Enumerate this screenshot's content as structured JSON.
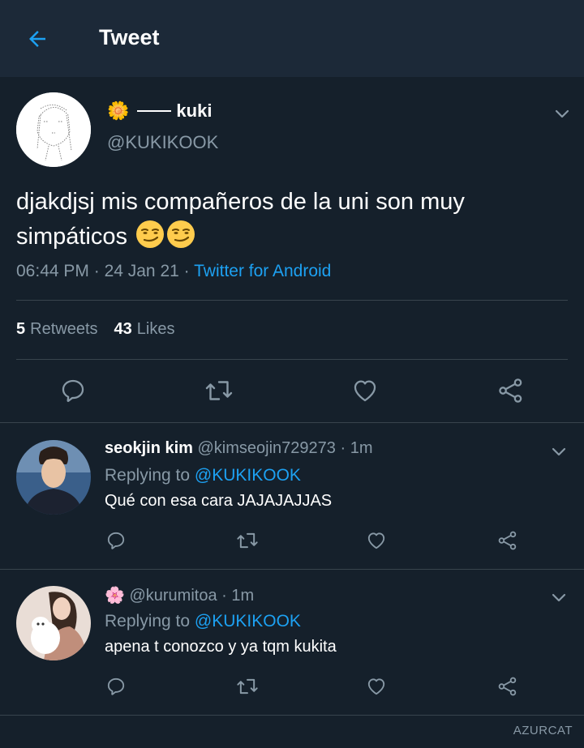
{
  "header": {
    "title": "Tweet"
  },
  "tweet": {
    "display_name": "kuki",
    "name_emoji": "🌼",
    "handle": "@KUKIKOOK",
    "text": "djakdjsj mis compañeros de la uni son muy simpáticos",
    "time": "06:44 PM",
    "date": "24 Jan 21",
    "client": "Twitter for Android",
    "retweets_count": "5",
    "retweets_label": "Retweets",
    "likes_count": "43",
    "likes_label": "Likes"
  },
  "replies": [
    {
      "name": "seokjin kim",
      "handle": "@kimseojin729273",
      "time": "1m",
      "replying_label": "Replying to",
      "mention": "@KUKIKOOK",
      "text": "Qué con esa cara JAJAJAJJAS"
    },
    {
      "name_emoji": "🌸",
      "handle": "@kurumitoa",
      "time": "1m",
      "replying_label": "Replying to",
      "mention": "@KUKIKOOK",
      "text": "apena t conozco y ya tqm kukita"
    }
  ],
  "watermark": "AZURCAT",
  "colors": {
    "background": "#15202b",
    "appbar": "#1c2938",
    "accent": "#1da1f2",
    "secondary_text": "#8899a6",
    "divider": "#38444d"
  },
  "icons": [
    "back-arrow-icon",
    "chevron-down-icon",
    "reply-icon",
    "retweet-icon",
    "like-icon",
    "share-icon",
    "smirk-emoji-icon"
  ]
}
